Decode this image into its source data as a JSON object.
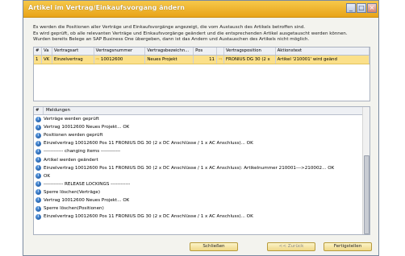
{
  "window": {
    "title": "Artikel im Vertrag/Einkaufsvorgang ändern",
    "controls": [
      "minimize-icon",
      "maximize-icon",
      "close-icon"
    ]
  },
  "description": [
    "Es werden die Positionen aller Verträge und Einkaufsvorgänge angezeigt, die vom Austausch des Artikels betroffen sind.",
    "Es wird geprüft, ob alle relevanten Verträge und Einkaufsvorgänge geändert und die entsprechenden Artikel ausgetauscht werden können.",
    "Wurden bereits Belege an SAP Business One übergeben, dann ist das Ändern und Austauschen des Artikels nicht möglich."
  ],
  "grid": {
    "columns": [
      "#",
      "Va",
      "Vertragsart",
      "Vertragsnummer",
      "Vertragsbezeichn...",
      "Pos",
      "",
      "Vertragsposition",
      "Aktionstext"
    ],
    "rows": [
      [
        "1",
        "VK",
        "Einzelvertrag",
        "10012600",
        "Neues Projekt",
        "11",
        "",
        "FRONIUS DG 30 (2 x",
        "Artikel '210001' wird geänd"
      ]
    ]
  },
  "log": {
    "columns": [
      "#",
      "Meldungen"
    ],
    "items": [
      "Verträge werden geprüft",
      "Vertrag 10012600 Neues Projekt... OK",
      "Positionen werden geprüft",
      "Einzelvertrag 10012600 Pos 11 FRONIUS DG 30 (2 x DC Anschlüsse / 1 x AC Anschluss)... OK",
      "------------ changing items ------------",
      "Artikel werden geändert",
      "Einzelvertrag 10012600 Pos 11 FRONIUS DG 30 (2 x DC Anschlüsse / 1 x AC Anschluss): Artikelnummer 210001--->210002... OK",
      "OK",
      "------------ RELEASE LOCKINGS ------------",
      "Sperre löschen(Verträge)",
      "Vertrag 10012600 Neues Projekt... OK",
      "Sperre löschen(Positionen)",
      "Einzelvertrag 10012600 Pos 11 FRONIUS DG 30 (2 x DC Anschlüsse / 1 x AC Anschluss)... OK"
    ]
  },
  "buttons": {
    "close": "Schließen",
    "back": "<< Zurück",
    "finish": "Fertigstellen"
  },
  "colors": {
    "titlebar": "#f0b52e",
    "selected_row": "#fbe08a",
    "info_icon": "#1f63b5"
  }
}
